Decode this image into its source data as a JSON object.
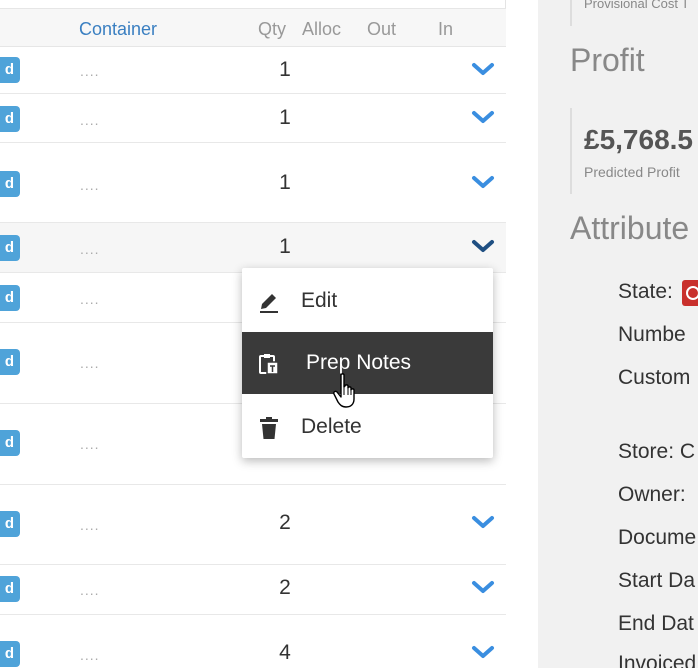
{
  "table": {
    "headers": {
      "container": "Container",
      "qty": "Qty",
      "alloc": "Alloc",
      "out": "Out",
      "in": "In"
    },
    "tag_letter": "d",
    "dots": "....",
    "rows": [
      {
        "qty": "1"
      },
      {
        "qty": "1"
      },
      {
        "qty": "1"
      },
      {
        "qty": "1"
      },
      {
        "qty": ""
      },
      {
        "qty": ""
      },
      {
        "qty": ""
      },
      {
        "qty": "2"
      },
      {
        "qty": "2"
      },
      {
        "qty": "4"
      }
    ]
  },
  "context_menu": {
    "items": [
      {
        "label": "Edit",
        "icon": "pencil-icon"
      },
      {
        "label": "Prep Notes",
        "icon": "clipboard-icon"
      },
      {
        "label": "Delete",
        "icon": "trash-icon"
      }
    ]
  },
  "panel": {
    "provisional_cost": "Provisional Cost T",
    "profit_title": "Profit",
    "profit_value": "£5,768.5",
    "profit_label": "Predicted Profit",
    "attributes_title": "Attribute",
    "attributes": [
      "State:",
      "Numbe",
      "Custom",
      "Store: C",
      "Owner:",
      "Docume",
      "Start Da",
      "End Dat",
      "Invoiced"
    ]
  },
  "colors": {
    "accent": "#3a7fc1",
    "tag": "#4fa3d9",
    "menu_highlight": "#3a3a3a",
    "state_badge": "#c9302c"
  }
}
